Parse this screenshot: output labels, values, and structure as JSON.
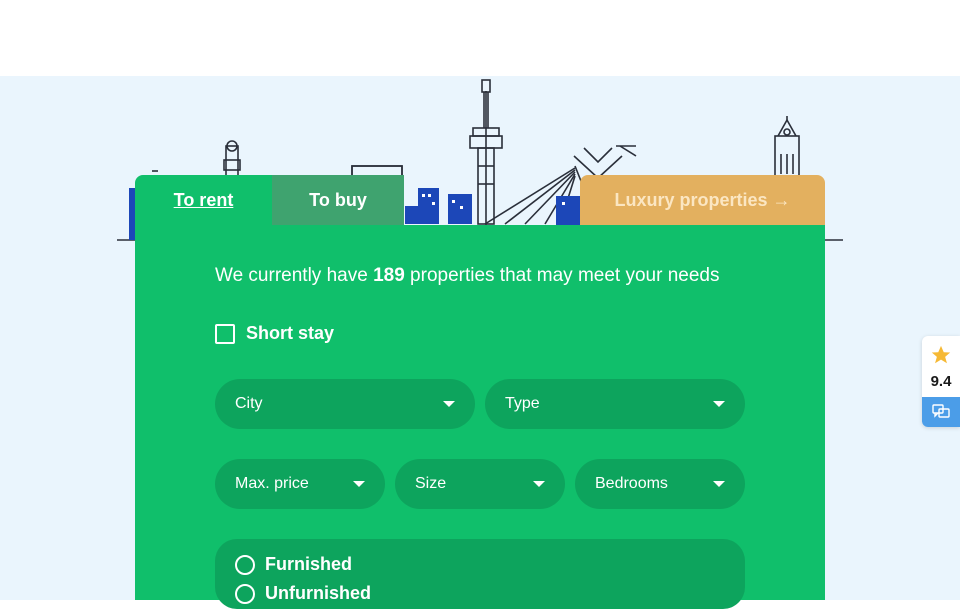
{
  "tabs": {
    "rent_label": "To rent",
    "buy_label": "To buy",
    "luxury_label": "Luxury properties →"
  },
  "search": {
    "headline_prefix": "We currently have ",
    "property_count": "189",
    "headline_suffix": " properties that may meet your needs",
    "short_stay_label": "Short stay",
    "short_stay_checked": false,
    "city_placeholder": "City",
    "type_placeholder": "Type",
    "max_price_placeholder": "Max. price",
    "size_placeholder": "Size",
    "bedrooms_placeholder": "Bedrooms",
    "furnished_label": "Furnished",
    "unfurnished_label": "Unfurnished"
  },
  "rating": {
    "score": "9.4",
    "star_icon": "star-icon",
    "chat_icon": "chat-icon"
  },
  "colors": {
    "accent_green": "#10bf6b",
    "tab_buy": "#3fa36f",
    "luxury_gold": "#e3b05f",
    "hero_bg": "#eaf5fd"
  }
}
